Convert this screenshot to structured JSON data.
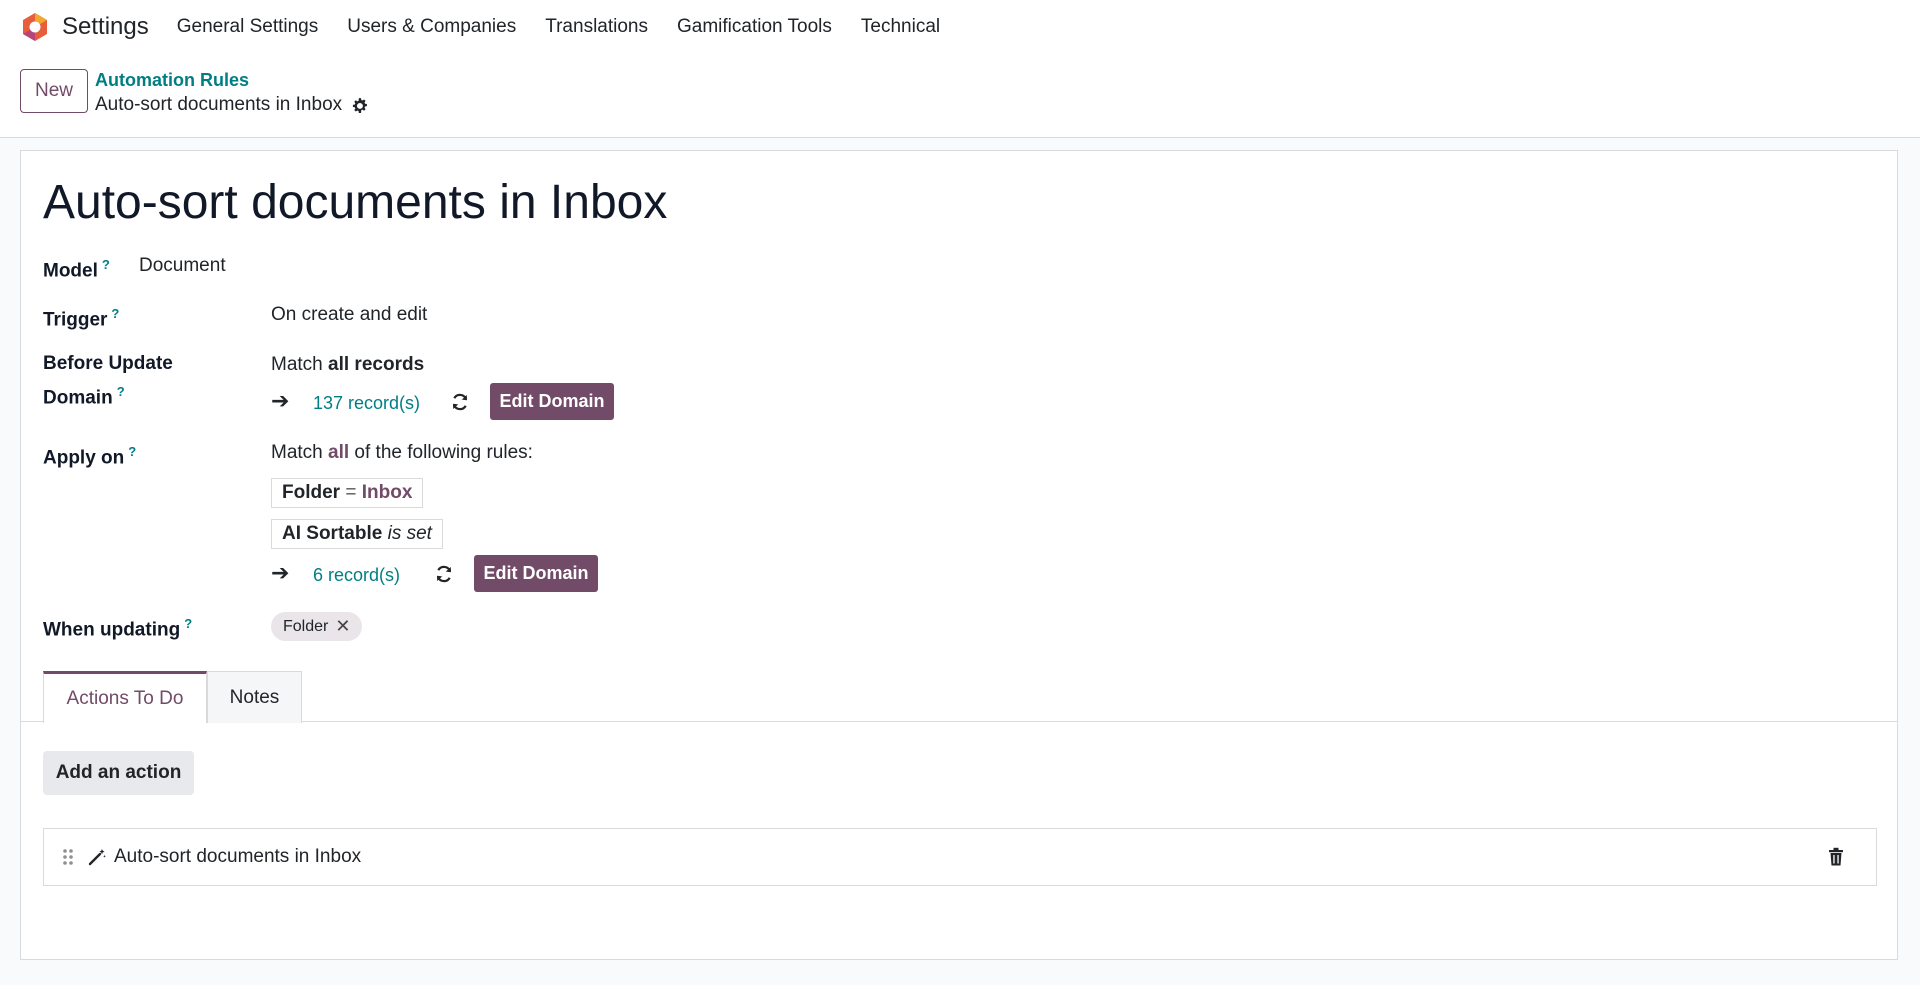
{
  "navbar": {
    "app_name": "Settings",
    "menu": [
      "General Settings",
      "Users & Companies",
      "Translations",
      "Gamification Tools",
      "Technical"
    ]
  },
  "control_panel": {
    "new_label": "New",
    "breadcrumb_parent": "Automation Rules",
    "breadcrumb_current": "Auto-sort documents in Inbox"
  },
  "form": {
    "title": "Auto-sort documents in Inbox",
    "help_mark": "?",
    "model_label": "Model",
    "model_value": "Document",
    "trigger_label": "Trigger",
    "trigger_value": "On create and edit",
    "before_update_label_1": "Before Update",
    "before_update_label_2": "Domain",
    "before_match_prefix": "Match ",
    "before_match_bold": "all records",
    "before_records": "137 record(s)",
    "edit_domain_label": "Edit Domain",
    "apply_on_label": "Apply on",
    "apply_match_prefix": "Match ",
    "apply_match_bold": "all",
    "apply_match_suffix": " of the following rules:",
    "rule1_field": "Folder",
    "rule1_op": "=",
    "rule1_value": "Inbox",
    "rule2_field": "AI Sortable",
    "rule2_op": "is set",
    "apply_records": "6 record(s)",
    "when_updating_label": "When updating",
    "when_updating_tag": "Folder"
  },
  "tabs": {
    "actions": "Actions To Do",
    "notes": "Notes"
  },
  "actions": {
    "add_label": "Add an action",
    "items": [
      {
        "name": "Auto-sort documents in Inbox"
      }
    ]
  },
  "colors": {
    "brand": "#714b67",
    "link": "#017e84"
  }
}
